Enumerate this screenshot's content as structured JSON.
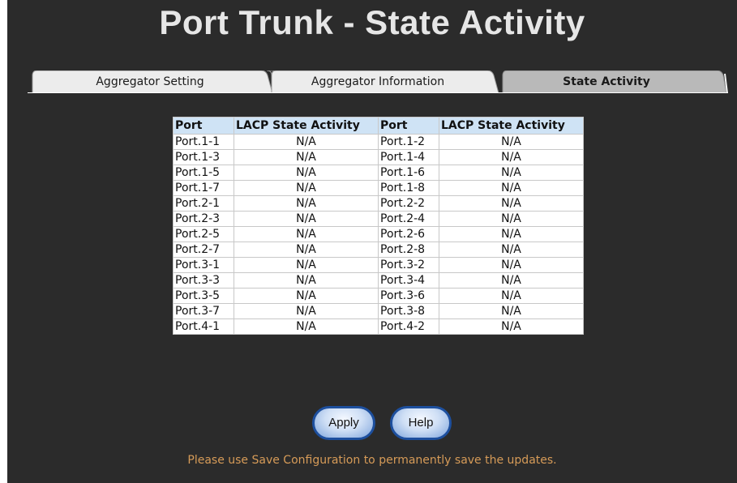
{
  "page": {
    "title": "Port Trunk - State Activity"
  },
  "tabs": [
    {
      "label": "Aggregator Setting",
      "active": false
    },
    {
      "label": "Aggregator Information",
      "active": false
    },
    {
      "label": "State Activity",
      "active": true
    }
  ],
  "table": {
    "headers": [
      "Port",
      "LACP State Activity",
      "Port",
      "LACP State Activity"
    ],
    "rows": [
      [
        "Port.1-1",
        "N/A",
        "Port.1-2",
        "N/A"
      ],
      [
        "Port.1-3",
        "N/A",
        "Port.1-4",
        "N/A"
      ],
      [
        "Port.1-5",
        "N/A",
        "Port.1-6",
        "N/A"
      ],
      [
        "Port.1-7",
        "N/A",
        "Port.1-8",
        "N/A"
      ],
      [
        "Port.2-1",
        "N/A",
        "Port.2-2",
        "N/A"
      ],
      [
        "Port.2-3",
        "N/A",
        "Port.2-4",
        "N/A"
      ],
      [
        "Port.2-5",
        "N/A",
        "Port.2-6",
        "N/A"
      ],
      [
        "Port.2-7",
        "N/A",
        "Port.2-8",
        "N/A"
      ],
      [
        "Port.3-1",
        "N/A",
        "Port.3-2",
        "N/A"
      ],
      [
        "Port.3-3",
        "N/A",
        "Port.3-4",
        "N/A"
      ],
      [
        "Port.3-5",
        "N/A",
        "Port.3-6",
        "N/A"
      ],
      [
        "Port.3-7",
        "N/A",
        "Port.3-8",
        "N/A"
      ],
      [
        "Port.4-1",
        "N/A",
        "Port.4-2",
        "N/A"
      ]
    ]
  },
  "buttons": {
    "apply_label": "Apply",
    "help_label": "Help"
  },
  "hint": "Please use Save Configuration to permanently save the updates.",
  "colors": {
    "panel_background": "#2b2b2b",
    "title_text": "#e6e6e6",
    "tab_inactive": "#ececec",
    "tab_active": "#b9b9b9",
    "table_header": "#cfe3f5",
    "button_border": "#1d4f9e",
    "hint_text": "#d69b58"
  }
}
